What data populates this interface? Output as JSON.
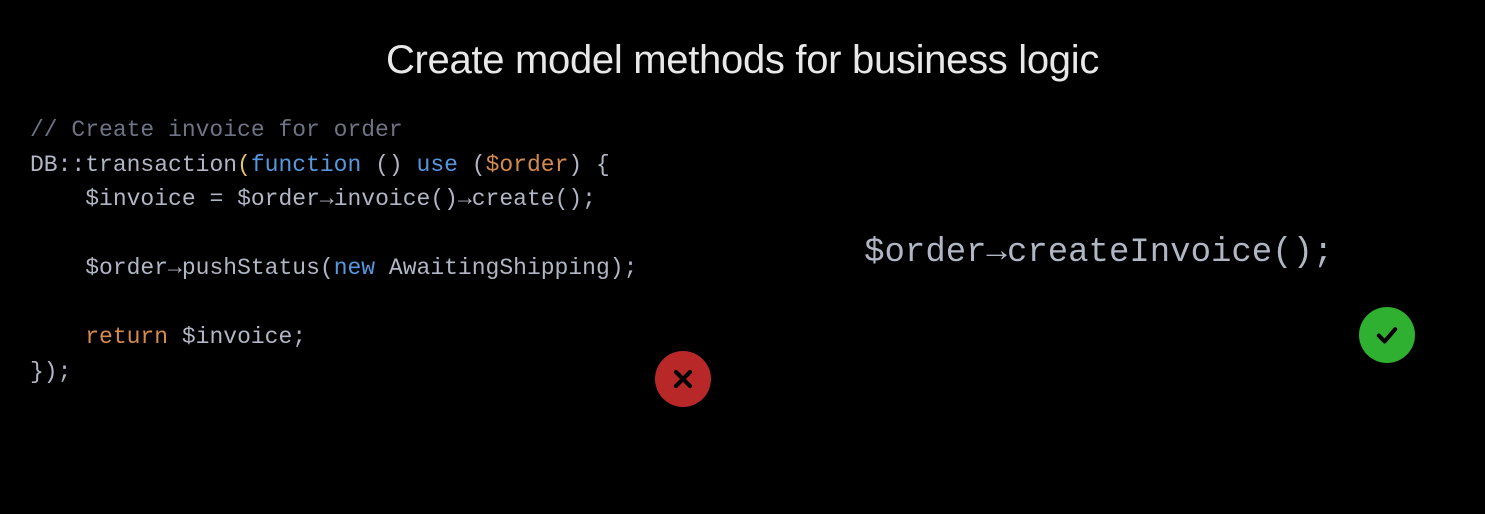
{
  "title": "Create model methods for business logic",
  "left_code": {
    "l1_comment": "// Create invoice for order",
    "l2_db": "DB",
    "l2_scope": "::",
    "l2_transaction": "transaction",
    "l2_paren_open": "(",
    "l2_function": "function",
    "l2_unit_parens": " ()",
    "l2_space": " ",
    "l2_use": "use",
    "l2_space2": " ",
    "l2_inner_paren_open": "(",
    "l2_order": "$order",
    "l2_inner_paren_close": ")",
    "l2_brace_open": " {",
    "l3_indent": "    ",
    "l3_invoice": "$invoice",
    "l3_eq": " = ",
    "l3_order": "$order",
    "l3_arrow1": "→",
    "l3_invoicefn": "invoice()",
    "l3_arrow2": "→",
    "l3_create": "create();",
    "l5_indent": "    ",
    "l5_order": "$order",
    "l5_arrow": "→",
    "l5_push": "pushStatus(",
    "l5_new": "new",
    "l5_space": " ",
    "l5_await": "AwaitingShipping",
    "l5_close": ");",
    "l7_indent": "    ",
    "l7_return": "return",
    "l7_space": " ",
    "l7_invoice": "$invoice",
    "l7_semi": ";",
    "l8_close": "});"
  },
  "right_code": {
    "order": "$order",
    "arrow": "→",
    "method": "createInvoice();"
  },
  "badges": {
    "bad": "cross-icon",
    "good": "check-icon"
  }
}
